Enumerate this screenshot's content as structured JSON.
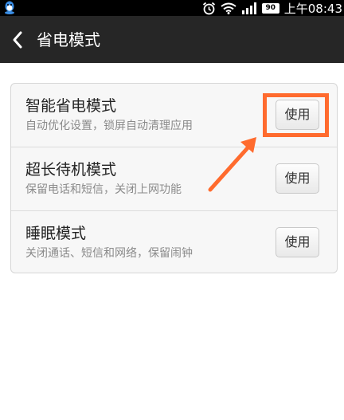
{
  "status_bar": {
    "battery_level": "90",
    "time": "上午08:43",
    "icons": [
      "qq-icon",
      "alarm-icon",
      "wifi-icon",
      "signal-icon",
      "battery-icon"
    ]
  },
  "header": {
    "title": "省电模式",
    "back_icon": "chevron-left-icon"
  },
  "modes": [
    {
      "title": "智能省电模式",
      "subtitle": "自动优化设置，锁屏自动清理应用",
      "button": "使用"
    },
    {
      "title": "超长待机模式",
      "subtitle": "保留电话和短信，关闭上网功能",
      "button": "使用"
    },
    {
      "title": "睡眠模式",
      "subtitle": "关闭通话、短信和网络，保留闹钟",
      "button": "使用"
    }
  ],
  "annotation": {
    "color": "#ff6b2e"
  }
}
